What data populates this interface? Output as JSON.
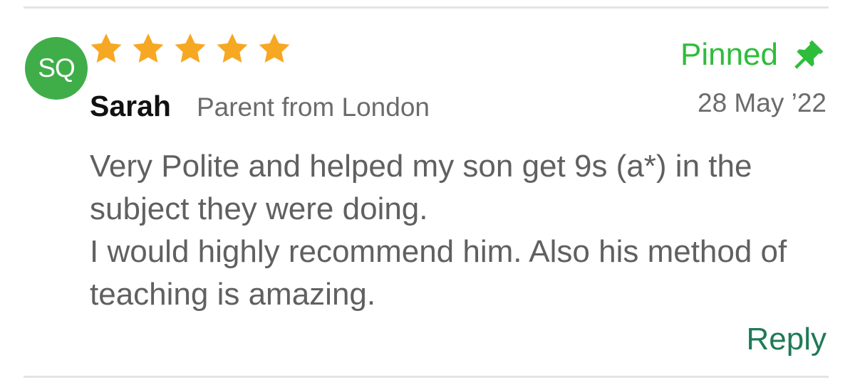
{
  "review": {
    "avatar_initials": "SQ",
    "rating": 5,
    "rating_max": 5,
    "reviewer_name": "Sarah",
    "reviewer_subtitle": "Parent from London",
    "pinned_label": "Pinned",
    "date": "28 May ’22",
    "body_lines": [
      "Very Polite and helped my son get 9s (a*) in the subject they were doing.",
      "I would highly recommend him. Also his method of teaching is amazing."
    ],
    "reply_label": "Reply"
  },
  "icons": {
    "star": "star-icon",
    "pin": "pin-icon"
  },
  "colors": {
    "avatar_bg": "#3fae49",
    "star": "#f6a823",
    "pinned": "#2ebd3a",
    "reply": "#1f7a57",
    "body_text": "#606060",
    "meta_text": "#6b6b6b"
  }
}
